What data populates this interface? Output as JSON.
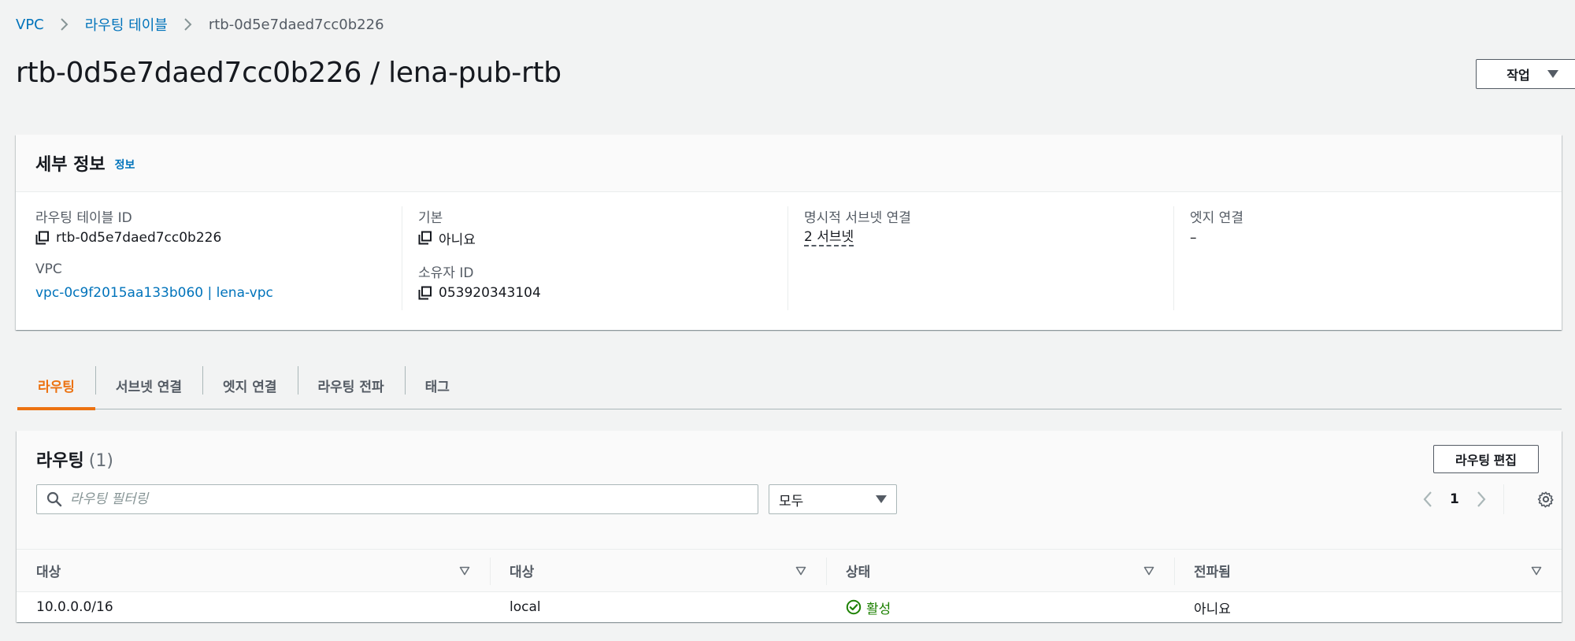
{
  "breadcrumb": {
    "items": [
      "VPC",
      "라우팅 테이블",
      "rtb-0d5e7daed7cc0b226"
    ]
  },
  "header": {
    "title": "rtb-0d5e7daed7cc0b226 / lena-pub-rtb",
    "actions_label": "작업"
  },
  "details": {
    "title": "세부 정보",
    "info_label": "정보",
    "route_table_id_label": "라우팅 테이블 ID",
    "route_table_id": "rtb-0d5e7daed7cc0b226",
    "vpc_label": "VPC",
    "vpc_value": "vpc-0c9f2015aa133b060 | lena-vpc",
    "main_label": "기본",
    "main_value": "아니요",
    "owner_label": "소유자 ID",
    "owner_value": "053920343104",
    "explicit_subnet_label": "명시적 서브넷 연결",
    "explicit_subnet_value": "2 서브넷",
    "edge_label": "엣지 연결",
    "edge_value": "–"
  },
  "tabs": [
    "라우팅",
    "서브넷 연결",
    "엣지 연결",
    "라우팅 전파",
    "태그"
  ],
  "routes": {
    "title": "라우팅",
    "count": "(1)",
    "edit_label": "라우팅 편집",
    "filter_placeholder": "라우팅 필터링",
    "select_value": "모두",
    "page": "1",
    "columns": [
      "대상",
      "대상",
      "상태",
      "전파됨"
    ],
    "rows": [
      {
        "destination": "10.0.0.0/16",
        "target": "local",
        "status": "활성",
        "propagated": "아니요"
      }
    ]
  },
  "colors": {
    "accent": "#ec7211",
    "link": "#0073bb",
    "success": "#1d8102"
  }
}
